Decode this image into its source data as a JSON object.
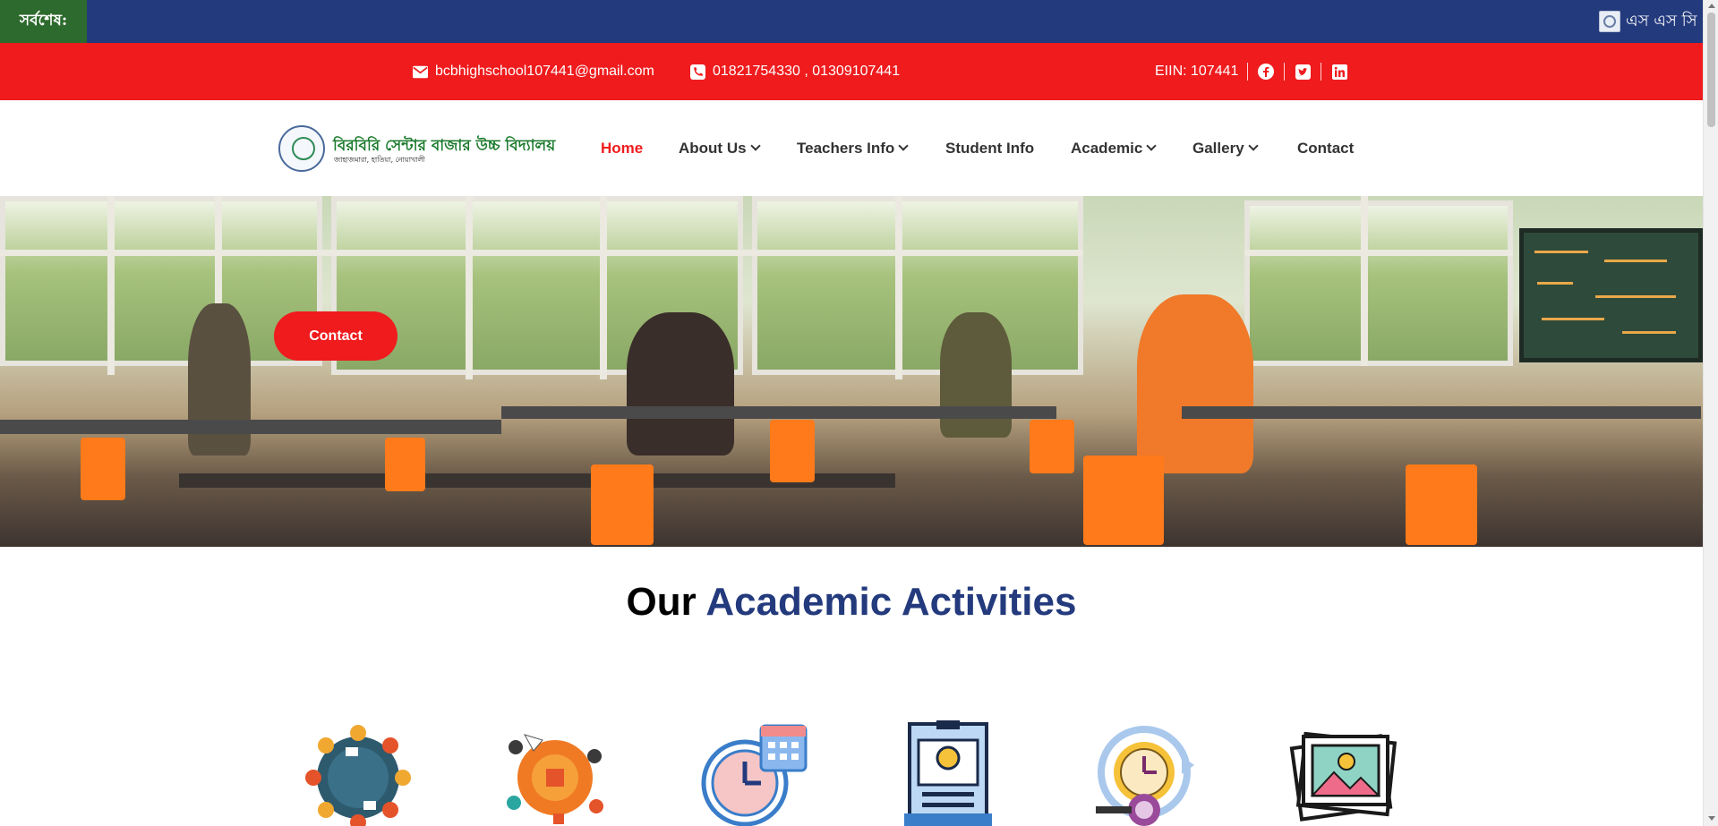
{
  "ticker": {
    "label": "সর্বশেষ:",
    "text": "এস এস সি প"
  },
  "topbar": {
    "email": "bcbhighschool107441@gmail.com",
    "phone": "01821754330 , 01309107441",
    "eiin": "EIIN: 107441",
    "social": [
      "facebook-icon",
      "twitter-icon",
      "linkedin-icon"
    ]
  },
  "header": {
    "school_name": "বিরবিরি সেন্টার বাজার উচ্চ বিদ্যালয়",
    "school_address": "জাহাজমারা, হাতিয়া, নোয়াখালী",
    "nav": [
      {
        "label": "Home",
        "active": true
      },
      {
        "label": "About Us",
        "dropdown": true
      },
      {
        "label": "Teachers Info",
        "dropdown": true
      },
      {
        "label": "Student Info"
      },
      {
        "label": "Academic",
        "dropdown": true
      },
      {
        "label": "Gallery",
        "dropdown": true
      },
      {
        "label": "Contact"
      }
    ]
  },
  "hero": {
    "button_label": "Contact"
  },
  "section": {
    "title_part1": "Our",
    "title_part2": "Academic Activities",
    "icons": [
      "group-discussion-icon",
      "teamwork-icon",
      "schedule-icon",
      "idea-board-icon",
      "target-time-icon",
      "gallery-icon"
    ]
  },
  "colors": {
    "ticker_bg": "#233a7d",
    "ticker_label_bg": "#2d6a2d",
    "topbar_bg": "#ef1b1d",
    "accent": "#ef1b1d",
    "title_blue": "#233a7d"
  }
}
